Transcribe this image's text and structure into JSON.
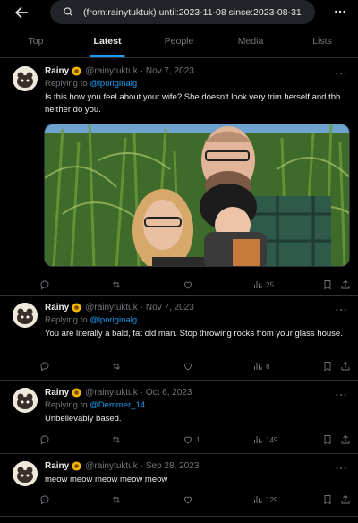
{
  "search": {
    "query": "(from:rainytuktuk) until:2023-11-08 since:2023-08-31"
  },
  "tabs": [
    {
      "label": "Top"
    },
    {
      "label": "Latest"
    },
    {
      "label": "People"
    },
    {
      "label": "Media"
    },
    {
      "label": "Lists"
    }
  ],
  "active_tab": "Latest",
  "tweets": [
    {
      "name": "Rainy",
      "handle": "@rainytuktuk",
      "date": "· Nov 7, 2023",
      "replying_prefix": "Replying to",
      "replying_to": "@lporiginalg",
      "text": "Is this how you feel about your wife? She doesn't look very trim herself and tbh neither do you.",
      "replies": "",
      "retweets": "",
      "likes": "",
      "views": "25"
    },
    {
      "name": "Rainy",
      "handle": "@rainytuktuk",
      "date": "· Nov 7, 2023",
      "replying_prefix": "Replying to",
      "replying_to": "@lporiginalg",
      "text": "You are literally a bald, fat old man. Stop throwing rocks from your glass house.",
      "replies": "",
      "retweets": "",
      "likes": "",
      "views": "8"
    },
    {
      "name": "Rainy",
      "handle": "@rainytuktuk",
      "date": "· Oct 6, 2023",
      "replying_prefix": "Replying to",
      "replying_to": "@Demmer_14",
      "text": "Unbelievably based.",
      "replies": "",
      "retweets": "",
      "likes": "1",
      "views": "149"
    },
    {
      "name": "Rainy",
      "handle": "@rainytuktuk",
      "date": "· Sep 28, 2023",
      "text": "meow meow meow meow meow",
      "replies": "",
      "retweets": "",
      "likes": "",
      "views": "129"
    }
  ],
  "colors": {
    "accent": "#1d9bf0",
    "background": "#000000",
    "muted": "#71767b",
    "border": "#2f3336"
  }
}
